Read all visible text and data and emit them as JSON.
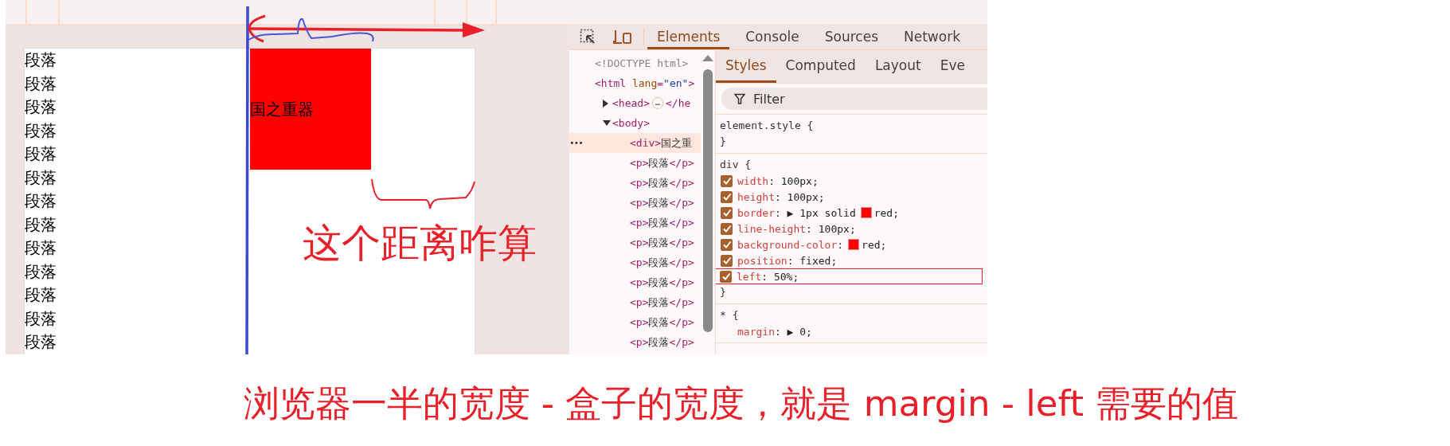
{
  "page": {
    "paragraphs": [
      "段落",
      "段落",
      "段落",
      "段落",
      "段落",
      "段落",
      "段落",
      "段落",
      "段落",
      "段落",
      "段落",
      "段落",
      "段落"
    ],
    "box_text": "国之重器"
  },
  "annotations": {
    "note": "这个距离咋算",
    "caption": "浏览器一半的宽度 - 盒子的宽度，就是 margin - left 需要的值"
  },
  "devtools": {
    "tabs": [
      {
        "label": "Elements",
        "selected": true
      },
      {
        "label": "Console",
        "selected": false
      },
      {
        "label": "Sources",
        "selected": false
      },
      {
        "label": "Network",
        "selected": false
      }
    ],
    "dom": [
      {
        "parts": [
          {
            "kind": "doctype",
            "t": "<!DOCTYPE html>"
          }
        ],
        "selected": false
      },
      {
        "parts": [
          {
            "kind": "tag",
            "t": "<html"
          },
          {
            "kind": "attr",
            "t": " lang"
          },
          {
            "kind": "tag",
            "t": "="
          },
          {
            "kind": "val",
            "t": "\"en\""
          },
          {
            "kind": "tag",
            "t": ">"
          }
        ],
        "selected": false,
        "children": [
          {
            "parts": [
              {
                "kind": "tag",
                "t": "<head>"
              },
              {
                "kind": "badge",
                "t": "…"
              },
              {
                "kind": "tag",
                "t": "</he"
              }
            ],
            "selected": false,
            "expanded": false
          },
          {
            "parts": [
              {
                "kind": "tag",
                "t": "<body>"
              }
            ],
            "selected": false,
            "expanded": true,
            "children": [
              {
                "gutter": "•••",
                "parts": [
                  {
                    "kind": "tag",
                    "t": "<div>"
                  },
                  {
                    "kind": "text",
                    "t": "国之重"
                  }
                ],
                "selected": true
              },
              {
                "parts": [
                  {
                    "kind": "tag",
                    "t": "<p>"
                  },
                  {
                    "kind": "text",
                    "t": "段落"
                  },
                  {
                    "kind": "tag",
                    "t": "</p>"
                  }
                ],
                "selected": false
              },
              {
                "parts": [
                  {
                    "kind": "tag",
                    "t": "<p>"
                  },
                  {
                    "kind": "text",
                    "t": "段落"
                  },
                  {
                    "kind": "tag",
                    "t": "</p>"
                  }
                ],
                "selected": false
              },
              {
                "parts": [
                  {
                    "kind": "tag",
                    "t": "<p>"
                  },
                  {
                    "kind": "text",
                    "t": "段落"
                  },
                  {
                    "kind": "tag",
                    "t": "</p>"
                  }
                ],
                "selected": false
              },
              {
                "parts": [
                  {
                    "kind": "tag",
                    "t": "<p>"
                  },
                  {
                    "kind": "text",
                    "t": "段落"
                  },
                  {
                    "kind": "tag",
                    "t": "</p>"
                  }
                ],
                "selected": false
              },
              {
                "parts": [
                  {
                    "kind": "tag",
                    "t": "<p>"
                  },
                  {
                    "kind": "text",
                    "t": "段落"
                  },
                  {
                    "kind": "tag",
                    "t": "</p>"
                  }
                ],
                "selected": false
              },
              {
                "parts": [
                  {
                    "kind": "tag",
                    "t": "<p>"
                  },
                  {
                    "kind": "text",
                    "t": "段落"
                  },
                  {
                    "kind": "tag",
                    "t": "</p>"
                  }
                ],
                "selected": false
              },
              {
                "parts": [
                  {
                    "kind": "tag",
                    "t": "<p>"
                  },
                  {
                    "kind": "text",
                    "t": "段落"
                  },
                  {
                    "kind": "tag",
                    "t": "</p>"
                  }
                ],
                "selected": false
              },
              {
                "parts": [
                  {
                    "kind": "tag",
                    "t": "<p>"
                  },
                  {
                    "kind": "text",
                    "t": "段落"
                  },
                  {
                    "kind": "tag",
                    "t": "</p>"
                  }
                ],
                "selected": false
              },
              {
                "parts": [
                  {
                    "kind": "tag",
                    "t": "<p>"
                  },
                  {
                    "kind": "text",
                    "t": "段落"
                  },
                  {
                    "kind": "tag",
                    "t": "</p>"
                  }
                ],
                "selected": false
              },
              {
                "parts": [
                  {
                    "kind": "tag",
                    "t": "<p>"
                  },
                  {
                    "kind": "text",
                    "t": "段落"
                  },
                  {
                    "kind": "tag",
                    "t": "</p>"
                  }
                ],
                "selected": false
              }
            ]
          }
        ]
      }
    ],
    "style_tabs": [
      {
        "label": "Styles",
        "selected": true
      },
      {
        "label": "Computed",
        "selected": false
      },
      {
        "label": "Layout",
        "selected": false
      },
      {
        "label": "Eve",
        "selected": false
      }
    ],
    "filter": {
      "placeholder": "Filter"
    },
    "rules": [
      {
        "selector": "element.style {",
        "close": "}"
      },
      {
        "selector": "div {",
        "close": "}",
        "props": [
          {
            "kind": "toggle",
            "checked": true,
            "highlighted": false,
            "name": "width",
            "value": [
              {
                "kind": "text",
                "t": ": 100px;"
              }
            ]
          },
          {
            "kind": "toggle",
            "checked": true,
            "highlighted": false,
            "name": "height",
            "value": [
              {
                "kind": "text",
                "t": ": 100px;"
              }
            ]
          },
          {
            "kind": "toggle",
            "checked": true,
            "highlighted": false,
            "name": "border",
            "value": [
              {
                "kind": "text",
                "t": ": ▶ 1px solid"
              },
              {
                "kind": "swatch",
                "color": "#ff0000"
              },
              {
                "kind": "text",
                "t": "red;"
              }
            ]
          },
          {
            "kind": "toggle",
            "checked": true,
            "highlighted": false,
            "name": "line-height",
            "value": [
              {
                "kind": "text",
                "t": ": 100px;"
              }
            ]
          },
          {
            "kind": "toggle",
            "checked": true,
            "highlighted": false,
            "name": "background-color",
            "value": [
              {
                "kind": "text",
                "t": ":"
              },
              {
                "kind": "swatch",
                "color": "#ff0000"
              },
              {
                "kind": "text",
                "t": "red;"
              }
            ]
          },
          {
            "kind": "toggle",
            "checked": true,
            "highlighted": false,
            "name": "position",
            "value": [
              {
                "kind": "text",
                "t": ": fixed;"
              }
            ]
          },
          {
            "kind": "toggle",
            "checked": true,
            "highlighted": true,
            "name": "left",
            "value": [
              {
                "kind": "text",
                "t": ": 50%;"
              }
            ]
          }
        ]
      },
      {
        "selector": "* {",
        "props": [
          {
            "kind": "plain",
            "highlighted": false,
            "name": "margin",
            "value": [
              {
                "kind": "text",
                "t": ": ▶ 0;"
              }
            ]
          }
        ]
      }
    ]
  }
}
